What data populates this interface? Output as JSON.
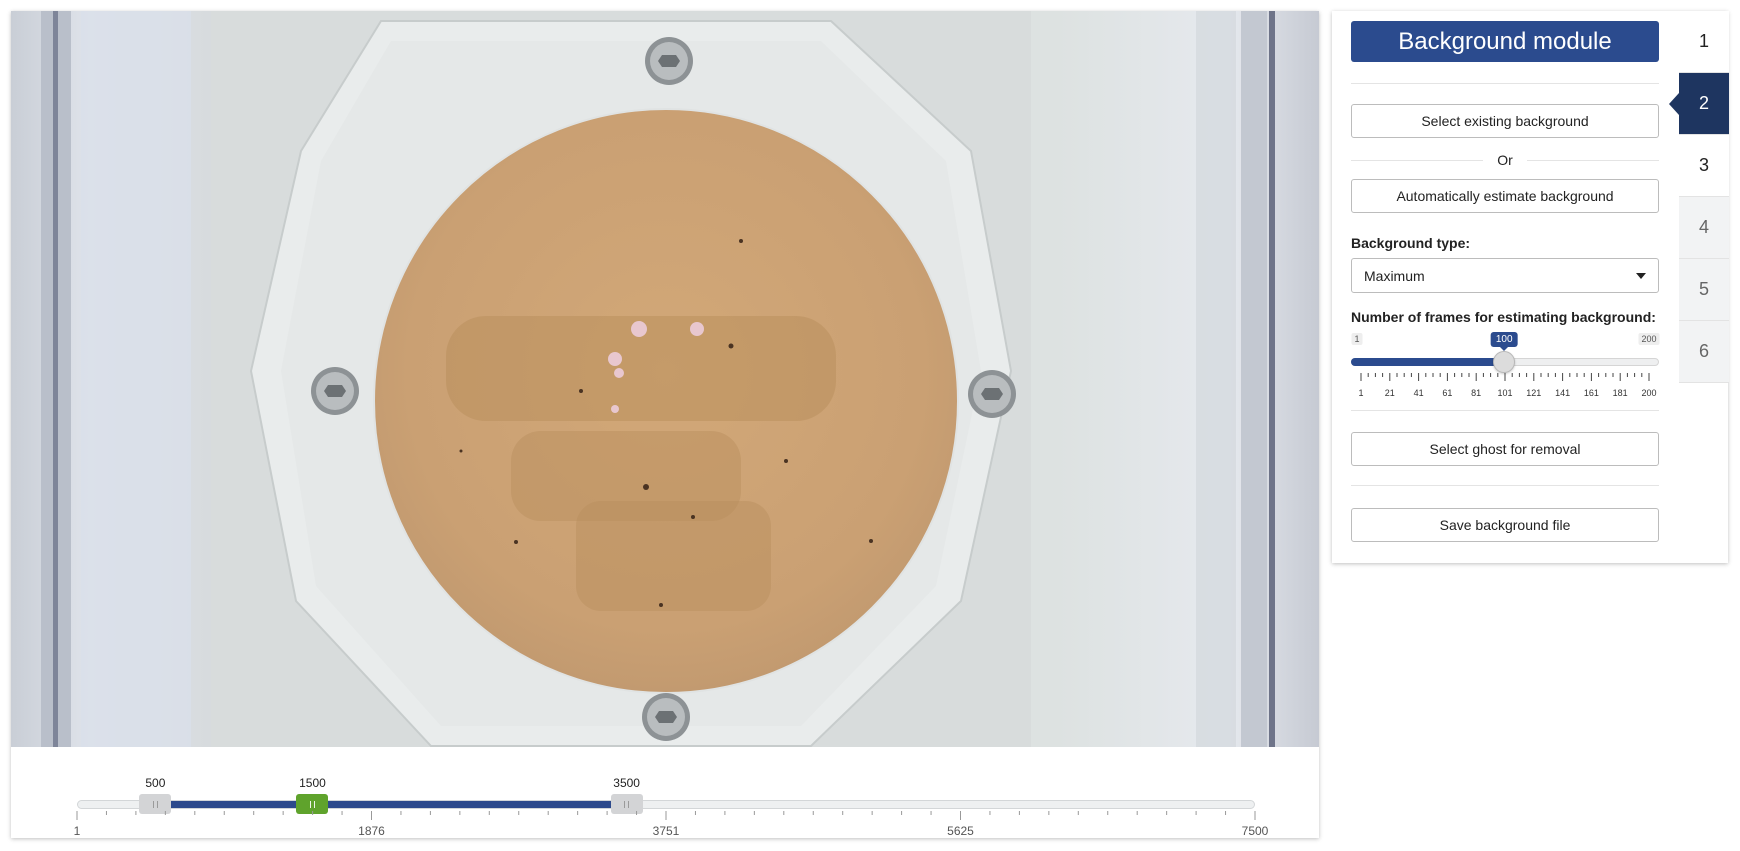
{
  "video": {
    "timeline": {
      "min": 1,
      "max": 7500,
      "handles": {
        "start": 500,
        "current": 1500,
        "end": 3500
      },
      "axis_labels": [
        "1",
        "1876",
        "3751",
        "5625",
        "7500"
      ],
      "value_labels": {
        "start": "500",
        "current": "1500",
        "end": "3500"
      }
    }
  },
  "panel": {
    "title": "Background module",
    "select_existing_label": "Select existing background",
    "or_label": "Or",
    "auto_estimate_label": "Automatically estimate background",
    "bg_type_label": "Background type:",
    "bg_type_value": "Maximum",
    "frames_label": "Number of frames for estimating background:",
    "frames_slider": {
      "min": 1,
      "max": 200,
      "value": 100,
      "min_label": "1",
      "max_label": "200",
      "value_label": "100",
      "tick_labels": [
        "1",
        "21",
        "41",
        "61",
        "81",
        "101",
        "121",
        "141",
        "161",
        "181",
        "200"
      ]
    },
    "ghost_label": "Select ghost for removal",
    "save_label": "Save background file"
  },
  "steps": {
    "tabs": [
      "1",
      "2",
      "3",
      "4",
      "5",
      "6"
    ],
    "active": "2",
    "enabled": [
      "1",
      "2",
      "3"
    ]
  },
  "colors": {
    "accent": "#2b4b8e",
    "active_tab": "#1e3560",
    "current_handle": "#5fa32c"
  }
}
